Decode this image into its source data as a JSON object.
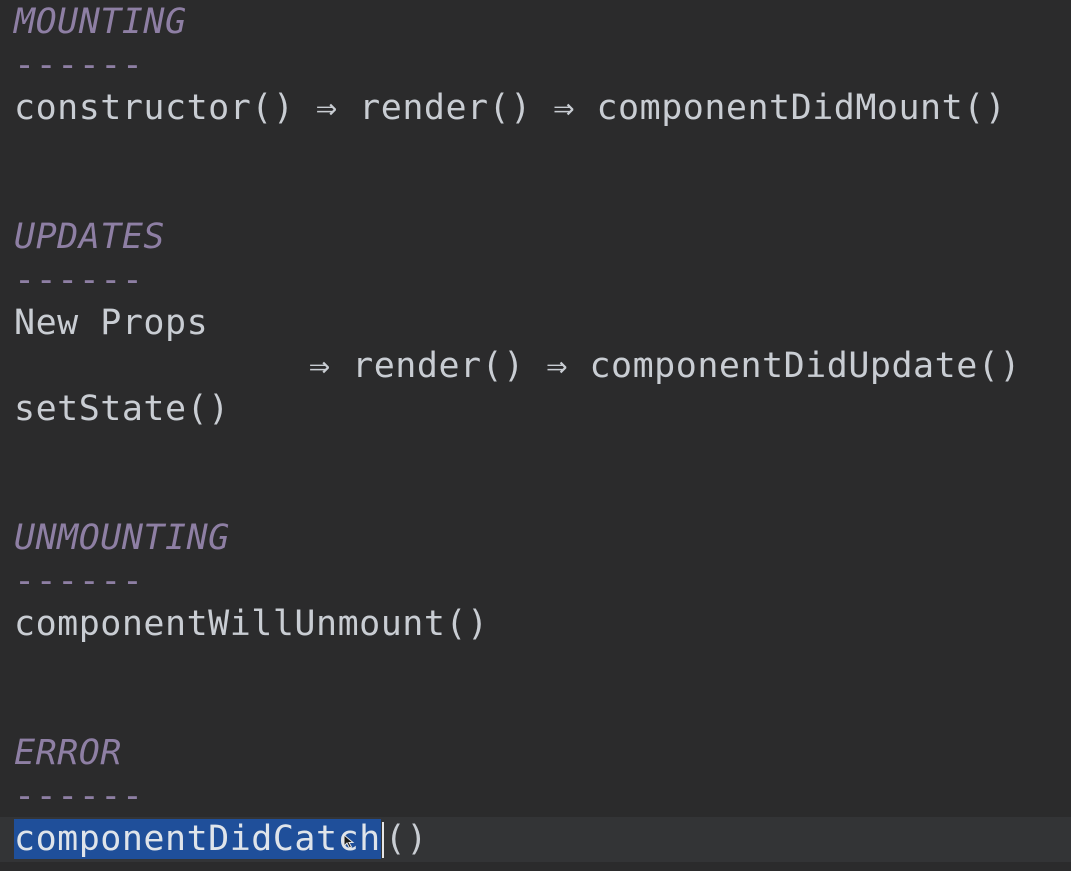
{
  "sections": {
    "mounting": {
      "heading": "MOUNTING",
      "rule": "------",
      "flow": {
        "step1": "constructor()",
        "arrow1": "⇒",
        "step2": "render()",
        "arrow2": "⇒",
        "step3": "componentDidMount()"
      }
    },
    "updates": {
      "heading": "UPDATES",
      "rule": "------",
      "trigger1": "New Props",
      "trigger2": "setState()",
      "flow": {
        "arrow1": "⇒",
        "step1": "render()",
        "arrow2": "⇒",
        "step2": "componentDidUpdate()"
      }
    },
    "unmounting": {
      "heading": "UNMOUNTING",
      "rule": "------",
      "step1": "componentWillUnmount()"
    },
    "error": {
      "heading": "ERROR",
      "rule": "------",
      "selected_text": "componentDidCatch",
      "rest_text": "()"
    }
  },
  "icons": {
    "pointer": "mouse-pointer-icon"
  },
  "colors": {
    "background": "#2b2b2c",
    "text": "#c9cdd3",
    "heading": "#8e7fa4",
    "selection": "#1f4f9a"
  }
}
